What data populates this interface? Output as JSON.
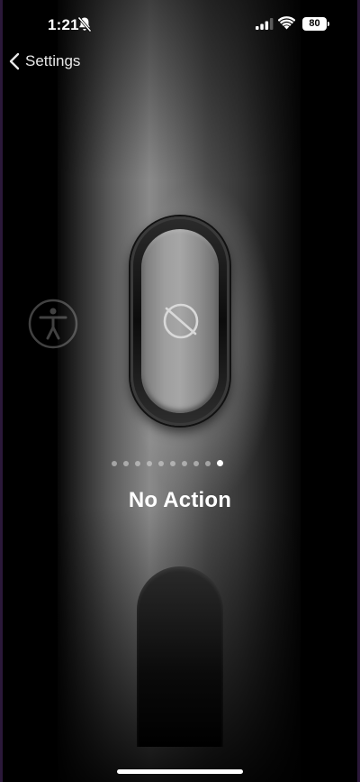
{
  "status_bar": {
    "time": "1:21",
    "battery_level": "80",
    "icons": [
      "bell-slash-icon",
      "cellular-signal-icon",
      "wifi-icon",
      "battery-icon"
    ]
  },
  "nav": {
    "back_label": "Settings",
    "back_icon": "chevron-left-icon"
  },
  "action_button": {
    "selected_action": "No Action",
    "icon": "circle-slash-icon",
    "page_count": 10,
    "active_page": 9
  },
  "side_icons": [
    "accessibility-icon"
  ],
  "colors": {
    "background": "#000000",
    "text": "#ffffff",
    "dot_inactive": "#c8c8c8",
    "dot_active": "#ffffff"
  }
}
